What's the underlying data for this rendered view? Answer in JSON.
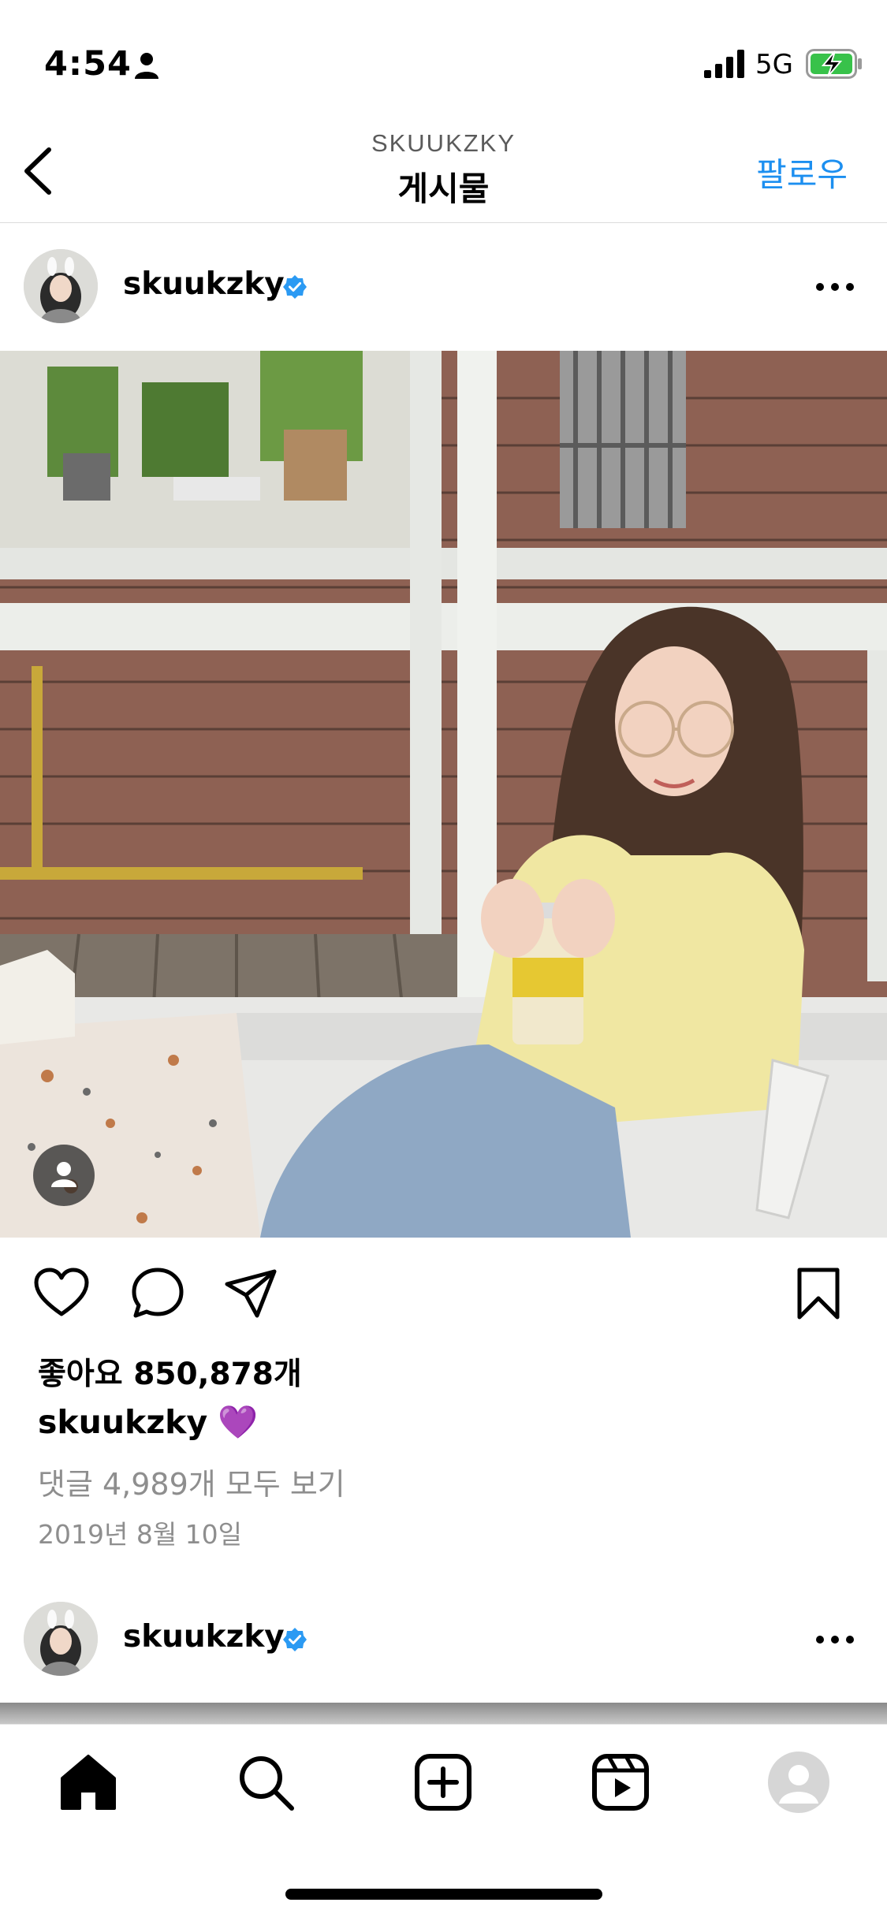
{
  "status_bar": {
    "time": "4:54",
    "network": "5G",
    "icons": [
      "person-icon",
      "signal-icon",
      "battery-charging-icon"
    ]
  },
  "nav": {
    "account": "SKUUKZKY",
    "title": "게시물",
    "follow_label": "팔로우"
  },
  "post": {
    "username": "skuukzky",
    "verified": true,
    "likes_text": "좋아요 850,878개",
    "caption_user": "skuukzky",
    "caption_emoji": "💜",
    "comments_text": "댓글 4,989개 모두 보기",
    "date_text": "2019년 8월 10일"
  },
  "next_post": {
    "username": "skuukzky",
    "verified": true
  },
  "tab_bar": {
    "items": [
      "home-icon",
      "search-icon",
      "create-icon",
      "reels-icon",
      "profile-icon"
    ]
  },
  "colors": {
    "accent": "#1c8ff0",
    "verified": "#2b9af3",
    "secondary_text": "#8e8e8e"
  }
}
